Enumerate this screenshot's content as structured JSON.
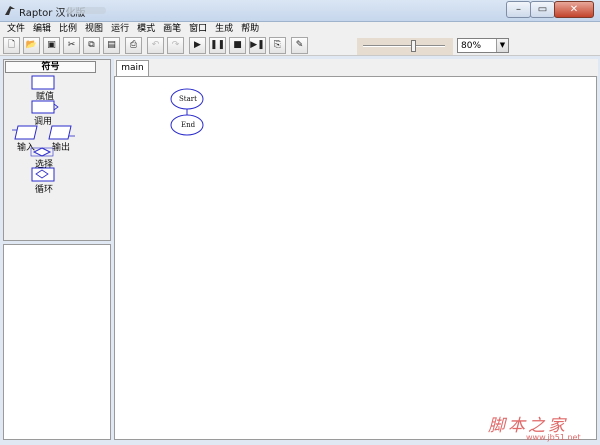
{
  "window": {
    "title": "Raptor 汉化版"
  },
  "menu": [
    "文件",
    "编辑",
    "比例",
    "视图",
    "运行",
    "模式",
    "画笔",
    "窗口",
    "生成",
    "帮助"
  ],
  "toolbar": {
    "buttons": [
      {
        "name": "new-file-icon",
        "glyph": "🗋",
        "enabled": true
      },
      {
        "name": "open-folder-icon",
        "glyph": "📂",
        "enabled": true
      },
      {
        "name": "save-icon",
        "glyph": "▣",
        "enabled": true
      },
      {
        "name": "cut-icon",
        "glyph": "✂",
        "enabled": true
      },
      {
        "name": "copy-icon",
        "glyph": "⧉",
        "enabled": true
      },
      {
        "name": "paste-icon",
        "glyph": "▤",
        "enabled": true
      },
      {
        "name": "print-icon",
        "glyph": "⎙",
        "enabled": true
      },
      {
        "name": "undo-icon",
        "glyph": "↶",
        "enabled": false
      },
      {
        "name": "redo-icon",
        "glyph": "↷",
        "enabled": false
      },
      {
        "name": "run-icon",
        "glyph": "▶",
        "enabled": true
      },
      {
        "name": "pause-icon",
        "glyph": "❚❚",
        "enabled": true
      },
      {
        "name": "stop-icon",
        "glyph": "■",
        "enabled": true
      },
      {
        "name": "step-icon",
        "glyph": "▶❚",
        "enabled": true
      },
      {
        "name": "breakpoint-icon",
        "glyph": "⎘",
        "enabled": true
      },
      {
        "name": "pen-icon",
        "glyph": "✎",
        "enabled": true
      }
    ],
    "speed_slider_level": 0.62,
    "zoom": "80%"
  },
  "symbols": {
    "header": "符号",
    "assign": "赋值",
    "call": "调用",
    "input": "输入",
    "output": "输出",
    "selection": "选择",
    "loop": "循环"
  },
  "tabs": [
    {
      "label": "main"
    }
  ],
  "flowchart": {
    "start": "Start",
    "end": "End"
  },
  "watermark": {
    "text": "脚本之家",
    "url": "www.jb51.net"
  },
  "colors": {
    "symbol_stroke": "#2b2bcc",
    "watermark": "#e06a6a"
  }
}
